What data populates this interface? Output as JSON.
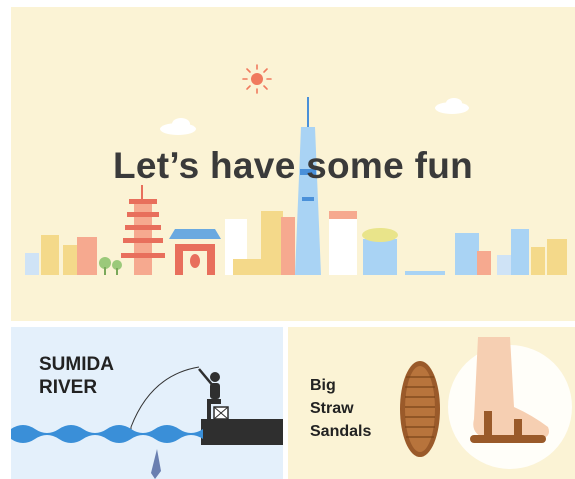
{
  "banner": {
    "headline": "Let’s have some fun",
    "bg_color": "#fbf3d5",
    "sun_color": "#f07a5e"
  },
  "panels": [
    {
      "title_lines": [
        "SUMIDA",
        "RIVER"
      ],
      "bg_color": "#e4f0fb",
      "water_color": "#3a8fd8"
    },
    {
      "title_lines": [
        "Big",
        "Straw",
        "Sandals"
      ],
      "bg_color": "#fbf3d5"
    }
  ]
}
